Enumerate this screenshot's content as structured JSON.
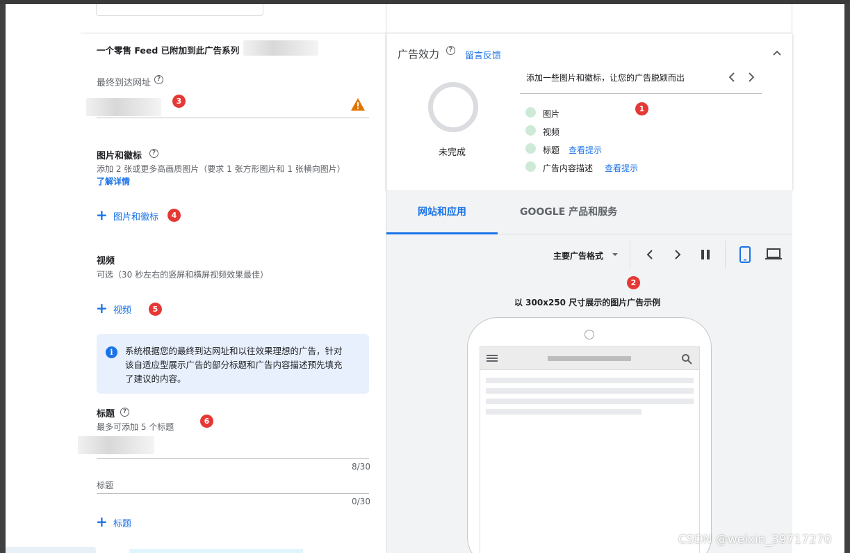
{
  "left": {
    "feed_notice": "一个零售 Feed 已附加到此广告系列",
    "final_url_label": "最终到达网址",
    "images_label": "图片和徽标",
    "images_desc": "添加 2 张或更多高画质图片（要求 1 张方形图片和 1 张横向图片）",
    "learn_more": "了解详情",
    "add_images": "图片和徽标",
    "video_label": "视频",
    "video_desc": "可选（30 秒左右的竖屏和横屏视频效果最佳）",
    "add_video": "视频",
    "info_line1": "系统根据您的最终到达网址和以往效果理想的广告，针对",
    "info_line2": "该自适应型展示广告的部分标题和广告内容描述预先填充",
    "info_line3": "了建议的内容。",
    "headline_label": "标题",
    "headline_desc": "最多可添加 5 个标题",
    "headline1_count": "8/30",
    "headline2_placeholder": "标题",
    "headline2_count": "0/30",
    "add_headline": "标题"
  },
  "perf": {
    "title": "广告效力",
    "feedback": "留言反馈",
    "status": "未完成",
    "tip": "添加一些图片和徽标，让您的广告脱颖而出",
    "items": [
      {
        "label": "图片",
        "link": ""
      },
      {
        "label": "视频",
        "link": ""
      },
      {
        "label": "标题",
        "link": "查看提示"
      },
      {
        "label": "广告内容描述",
        "link": "查看提示"
      }
    ]
  },
  "preview": {
    "tab1": "网站和应用",
    "tab2": "GOOGLE 产品和服务",
    "format": "主要广告格式",
    "caption": "以 300x250 尺寸展示的图片广告示例"
  },
  "badges": [
    "1",
    "2",
    "3",
    "4",
    "5",
    "6"
  ],
  "watermark": "CSDN @weixin_39717270",
  "colors": {
    "accent": "#1a73e8",
    "badge": "#e53935",
    "warning": "#e37400",
    "info_bg": "#e8f0fe"
  }
}
